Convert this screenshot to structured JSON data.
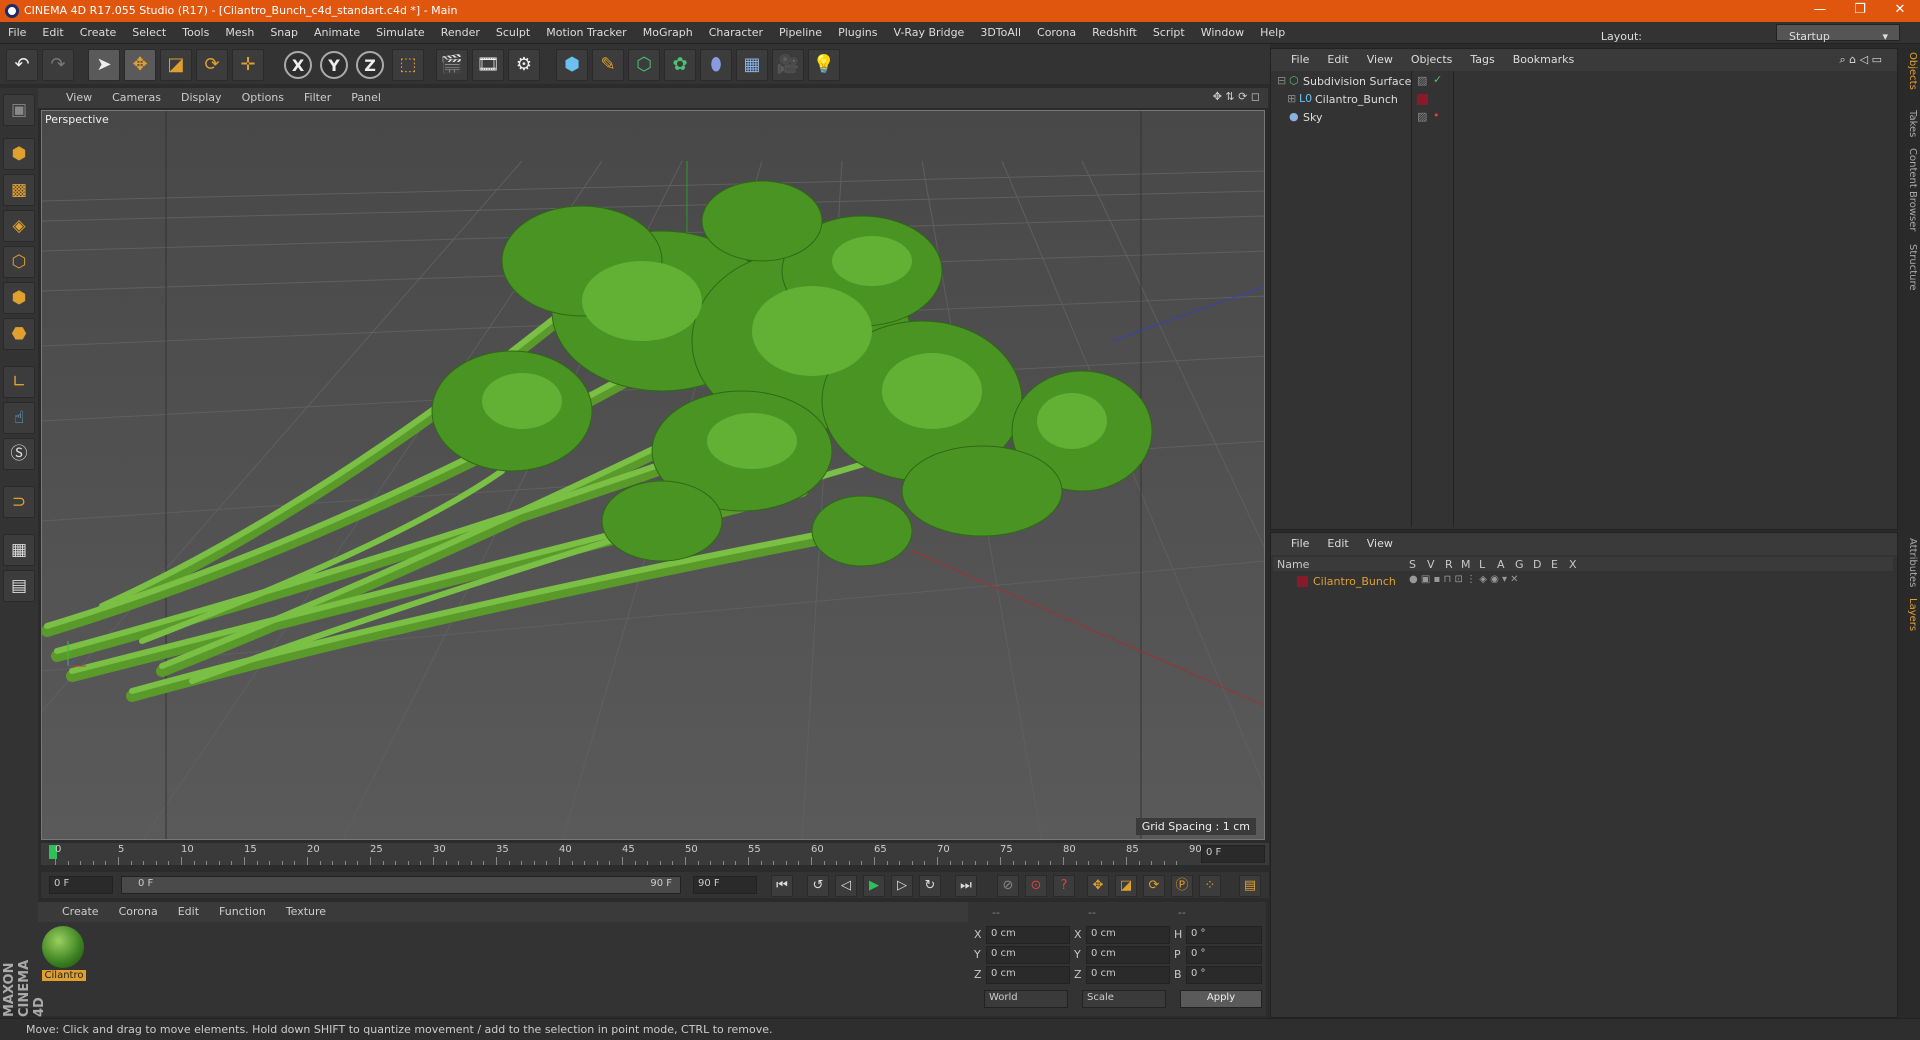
{
  "title": {
    "text": "CINEMA 4D R17.055 Studio (R17) - [Cilantro_Bunch_c4d_standart.c4d *] - Main",
    "minimize": "—",
    "restore": "❐",
    "close": "✕"
  },
  "menubar": {
    "items": [
      "File",
      "Edit",
      "Create",
      "Select",
      "Tools",
      "Mesh",
      "Snap",
      "Animate",
      "Simulate",
      "Render",
      "Sculpt",
      "Motion Tracker",
      "MoGraph",
      "Character",
      "Pipeline",
      "Plugins",
      "V-Ray Bridge",
      "3DToAll",
      "Corona",
      "Redshift",
      "Script",
      "Window",
      "Help"
    ],
    "layout_label": "Layout:",
    "layout_value": "Startup"
  },
  "viewport": {
    "menu": [
      "View",
      "Cameras",
      "Display",
      "Options",
      "Filter",
      "Panel"
    ],
    "label": "Perspective",
    "grid_spacing": "Grid Spacing : 1 cm"
  },
  "timeline": {
    "ticks": [
      "0",
      "5",
      "10",
      "15",
      "20",
      "25",
      "30",
      "35",
      "40",
      "45",
      "50",
      "55",
      "60",
      "65",
      "70",
      "75",
      "80",
      "85",
      "90"
    ],
    "current_frame": "0 F",
    "start_field": "0 F",
    "range_start": "0 F",
    "range_end": "90 F",
    "end_field": "90 F"
  },
  "material": {
    "menu": [
      "Create",
      "Corona",
      "Edit",
      "Function",
      "Texture"
    ],
    "items": [
      {
        "name": "Cilantro"
      }
    ]
  },
  "coords": {
    "header": [
      "--",
      "--",
      "--"
    ],
    "rows": [
      {
        "a": "X",
        "av": "0 cm",
        "b": "X",
        "bv": "0 cm",
        "c": "H",
        "cv": "0 °"
      },
      {
        "a": "Y",
        "av": "0 cm",
        "b": "Y",
        "bv": "0 cm",
        "c": "P",
        "cv": "0 °"
      },
      {
        "a": "Z",
        "av": "0 cm",
        "b": "Z",
        "bv": "0 cm",
        "c": "B",
        "cv": "0 °"
      }
    ],
    "world": "World",
    "scale": "Scale",
    "apply": "Apply"
  },
  "objects": {
    "menu": [
      "File",
      "Edit",
      "View",
      "Objects",
      "Tags",
      "Bookmarks"
    ],
    "items": [
      "Subdivision Surface",
      "Cilantro_Bunch",
      "Sky"
    ]
  },
  "layers": {
    "menu": [
      "File",
      "Edit",
      "View"
    ],
    "columns": [
      "Name",
      "S",
      "V",
      "R",
      "M",
      "L",
      "A",
      "G",
      "D",
      "E",
      "X"
    ],
    "items": [
      {
        "name": "Cilantro_Bunch",
        "color": "#8a1a2a"
      }
    ]
  },
  "sidetabs": [
    "Objects",
    "Takes",
    "Content Browser",
    "Structure",
    "Attributes",
    "Layers"
  ],
  "status": "Move: Click and drag to move elements. Hold down SHIFT to quantize movement / add to the selection in point mode, CTRL to remove.",
  "brand": "MAXON CINEMA 4D",
  "colors": {
    "titlebar": "#e0560f",
    "leaf": "#4e9a2a",
    "stem": "#6cb43c",
    "accent": "#e0a030"
  }
}
